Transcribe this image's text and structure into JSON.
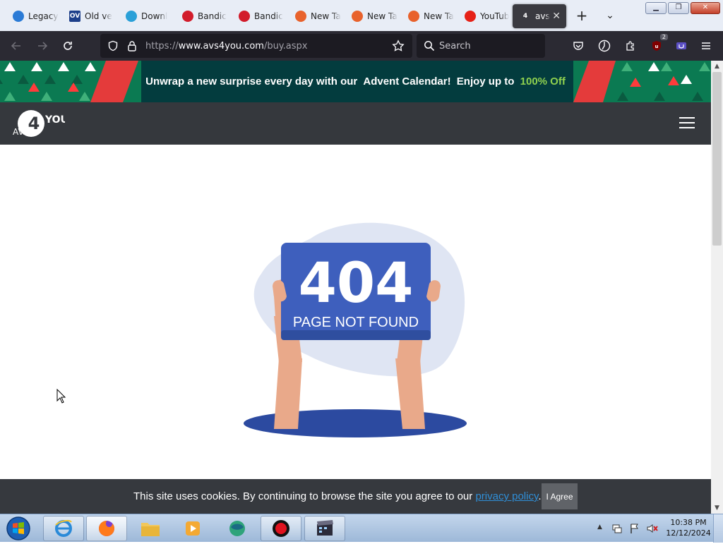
{
  "browser": {
    "tabs": [
      {
        "label": "Legacy",
        "icon": "globe-icon",
        "color": "#2b7bd6"
      },
      {
        "label": "Old ve",
        "icon": "oldversion-icon",
        "color": "#1d3f8a",
        "icon_text": "OV"
      },
      {
        "label": "Downl",
        "icon": "download-icon",
        "color": "#2aa0d8"
      },
      {
        "label": "Bandic",
        "icon": "bandicam-icon",
        "color": "#d21c2b"
      },
      {
        "label": "Bandic",
        "icon": "bandicam-icon",
        "color": "#d21c2b"
      },
      {
        "label": "New Ta",
        "icon": "firefox-icon",
        "color": "#e8622c"
      },
      {
        "label": "New Ta",
        "icon": "firefox-icon",
        "color": "#e8622c"
      },
      {
        "label": "New Ta",
        "icon": "firefox-icon",
        "color": "#e8622c"
      },
      {
        "label": "YouTub",
        "icon": "youtube-icon",
        "color": "#e62117"
      },
      {
        "label": "avs",
        "icon": "avs4you-icon",
        "color": "#ffffff",
        "icon_text": "4",
        "active": true
      }
    ],
    "url_scheme": "https://",
    "url_host": "www.avs4you.com",
    "url_path": "/buy.aspx",
    "search_placeholder": "Search",
    "extension_badge": "2"
  },
  "page": {
    "promo": {
      "lead": "Unwrap a new surprise every day with our",
      "highlight": "Advent Calendar!",
      "mid": "Enjoy up to",
      "offer": "100% Off"
    },
    "logo_top": "YOU",
    "logo_num": "4",
    "logo_bottom": "AVS",
    "error_code": "404",
    "error_message": "PAGE NOT FOUND",
    "cookie": {
      "text": "This site uses cookies. By continuing to browse the site you agree to our",
      "link": "privacy policy",
      "end": ".",
      "button": "I Agree"
    }
  },
  "taskbar": {
    "time": "10:38 PM",
    "date": "12/12/2024"
  },
  "colors": {
    "promo_bg": "#033c3e",
    "promo_accent": "#8fd14f",
    "header_bg": "#35383d",
    "sign_blue": "#3e5fbd",
    "link_blue": "#2f8fd8"
  }
}
